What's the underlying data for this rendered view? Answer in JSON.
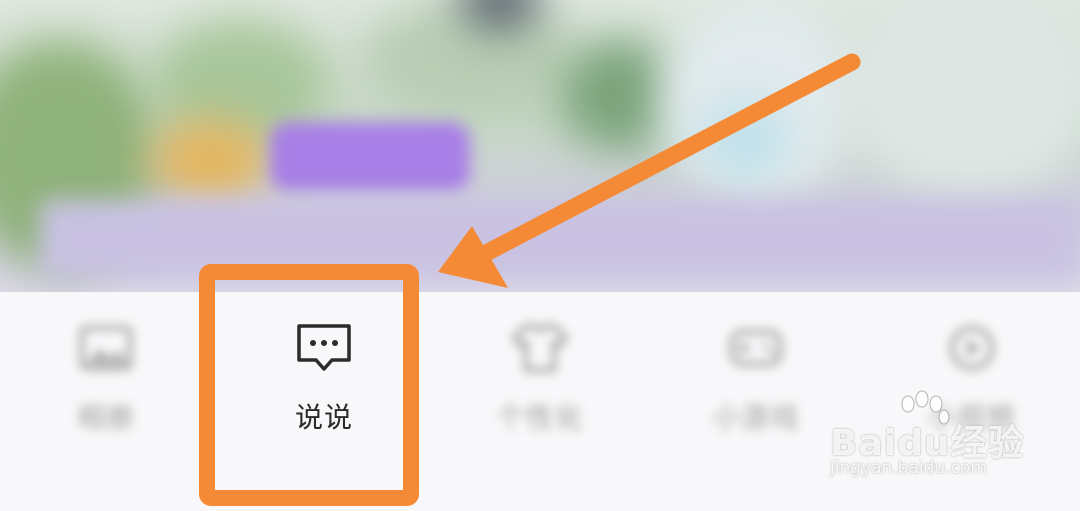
{
  "menu": {
    "items": [
      {
        "label": "相册",
        "icon": "photo-icon"
      },
      {
        "label": "说说",
        "icon": "chat-bubble-icon"
      },
      {
        "label": "个性化",
        "icon": "shirt-icon"
      },
      {
        "label": "小游戏",
        "icon": "game-icon"
      },
      {
        "label": "小视频",
        "icon": "video-icon"
      }
    ]
  },
  "annotation": {
    "highlight_color": "#f58a36",
    "highlighted_item": "说说"
  },
  "watermark": {
    "brand": "Baidu经验",
    "url": "jingyan.baidu.com"
  }
}
